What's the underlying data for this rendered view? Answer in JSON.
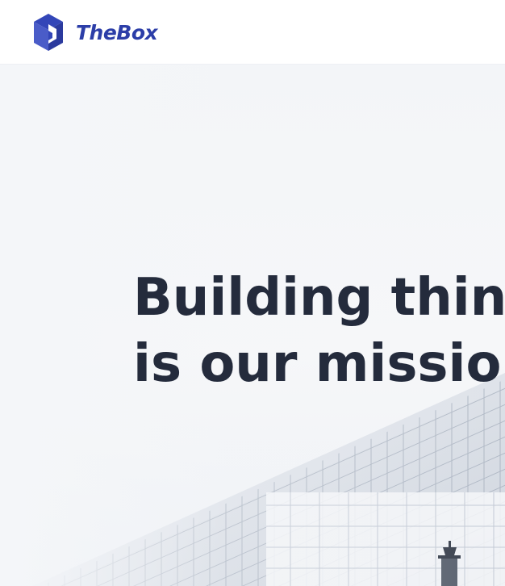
{
  "header": {
    "brand": "TheBox",
    "logo_icon": "cube-logo-icon",
    "brand_color": "#2c3ea8"
  },
  "hero": {
    "title_line1": "Building things",
    "title_line2": "is our mission",
    "title_color": "#242b3c",
    "background_image": "glass-building-photo"
  }
}
